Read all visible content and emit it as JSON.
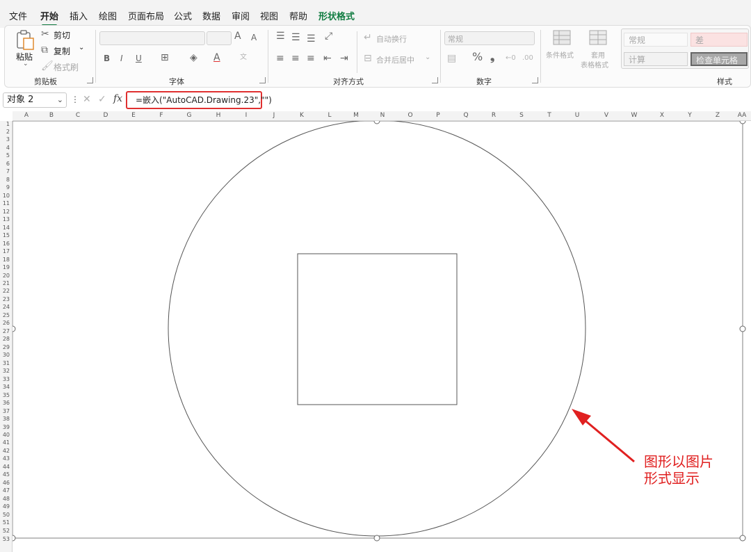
{
  "tabs": [
    "文件",
    "开始",
    "插入",
    "绘图",
    "页面布局",
    "公式",
    "数据",
    "审阅",
    "视图",
    "帮助",
    "形状格式"
  ],
  "clipboard": {
    "paste": "粘贴",
    "cut": "剪切",
    "copy": "复制",
    "format_painter": "格式刷",
    "group": "剪贴板"
  },
  "font": {
    "group": "字体",
    "bold": "B",
    "italic": "I",
    "underline": "U",
    "grow": "A",
    "shrink": "A"
  },
  "alignment": {
    "wrap": "自动换行",
    "merge": "合并后居中",
    "group": "对齐方式"
  },
  "number": {
    "format": "常规",
    "percent": "%",
    "comma": "❟",
    "group": "数字"
  },
  "styles": {
    "conditional": "条件格式",
    "table_format_1": "套用",
    "table_format_2": "表格格式",
    "normal": "常规",
    "bad": "差",
    "calc": "计算",
    "check": "检查单元格",
    "group": "样式"
  },
  "formula_bar": {
    "name_box": "对象 2",
    "fx": "fx",
    "formula": "=嵌入(\"AutoCAD.Drawing.23\",\"\")"
  },
  "columns": [
    "A",
    "B",
    "C",
    "D",
    "E",
    "F",
    "G",
    "H",
    "I",
    "J",
    "K",
    "L",
    "M",
    "N",
    "O",
    "P",
    "Q",
    "R",
    "S",
    "T",
    "U",
    "V",
    "W",
    "X",
    "Y",
    "Z",
    "AA"
  ],
  "rows": [
    "1",
    "2",
    "3",
    "4",
    "5",
    "6",
    "7",
    "8",
    "9",
    "10",
    "11",
    "12",
    "13",
    "14",
    "15",
    "16",
    "17",
    "18",
    "19",
    "20",
    "21",
    "22",
    "23",
    "24",
    "25",
    "26",
    "27",
    "28",
    "29",
    "30",
    "31",
    "32",
    "33",
    "34",
    "35",
    "36",
    "37",
    "38",
    "39",
    "40",
    "41",
    "42",
    "43",
    "44",
    "45",
    "46",
    "47",
    "48",
    "49",
    "50",
    "51",
    "52",
    "53"
  ],
  "callout": {
    "line1": "图形以图片",
    "line2": "形式显示"
  },
  "colors": {
    "accent": "#107c41",
    "highlight": "#e03030"
  }
}
